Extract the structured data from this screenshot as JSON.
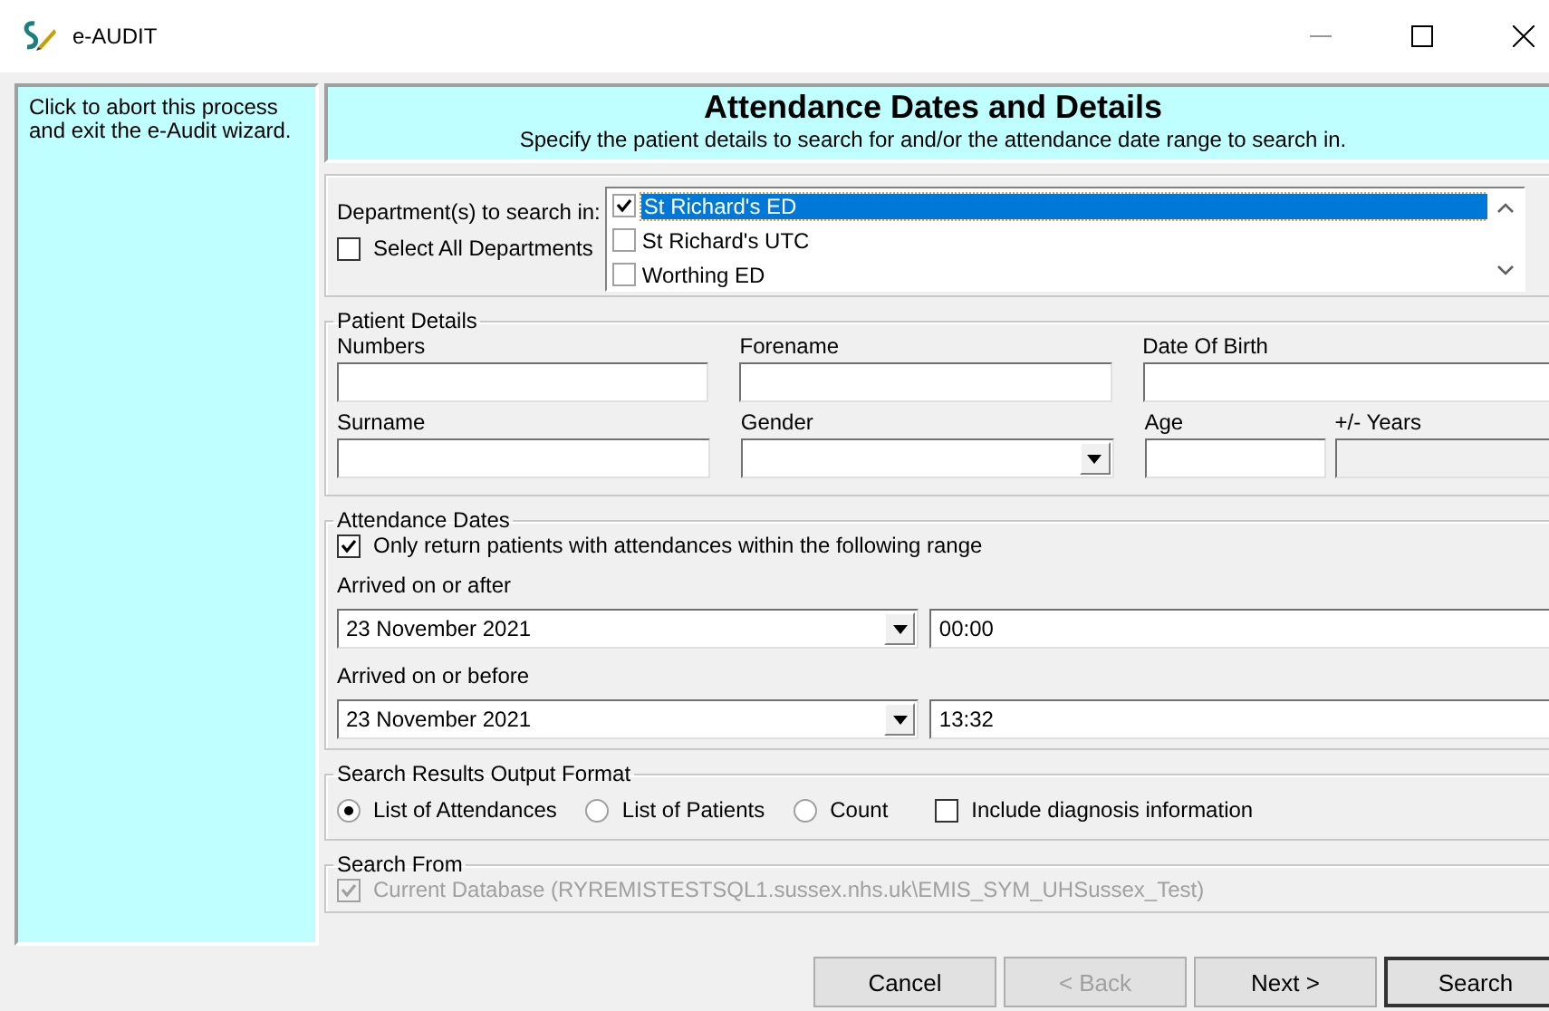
{
  "window": {
    "title": "e-AUDIT"
  },
  "abort_panel": {
    "text": "Click to abort this process and exit the e-Audit wizard."
  },
  "header": {
    "title": "Attendance Dates and Details",
    "subtitle": "Specify the patient details to search for and/or the attendance date range to search in."
  },
  "departments": {
    "label": "Department(s) to search in:",
    "select_all": {
      "label": "Select All Departments",
      "checked": false
    },
    "items": [
      {
        "label": "St Richard's ED",
        "checked": true,
        "selected": true
      },
      {
        "label": "St Richard's UTC",
        "checked": false,
        "selected": false
      },
      {
        "label": "Worthing ED",
        "checked": false,
        "selected": false
      }
    ]
  },
  "patient_details": {
    "legend": "Patient Details",
    "rows": [
      [
        {
          "label": "Numbers",
          "kind": "text"
        },
        {
          "label": "Forename",
          "kind": "text"
        },
        {
          "label": "Date Of Birth",
          "kind": "text"
        }
      ],
      [
        {
          "label": "Surname",
          "kind": "text"
        },
        {
          "label": "Gender",
          "kind": "dropdown"
        },
        {
          "label": "Age",
          "kind": "text"
        },
        {
          "label": "+/- Years",
          "kind": "disabled"
        }
      ]
    ]
  },
  "attendance_dates": {
    "legend": "Attendance Dates",
    "range_only": {
      "label": "Only return patients with attendances within the following range",
      "checked": true
    },
    "ranges": [
      {
        "label": "Arrived on or after",
        "date": "23 November 2021",
        "time": "00:00"
      },
      {
        "label": "Arrived on or before",
        "date": "23 November 2021",
        "time": "13:32"
      }
    ]
  },
  "output_format": {
    "legend": "Search Results Output Format",
    "options": [
      {
        "label": "List of Attendances",
        "selected": true
      },
      {
        "label": "List of Patients",
        "selected": false
      },
      {
        "label": "Count",
        "selected": false
      }
    ],
    "include_diagnosis": {
      "label": "Include diagnosis information",
      "checked": false
    }
  },
  "search_from": {
    "legend": "Search From",
    "database": {
      "label": "Current Database (RYREMISTESTSQL1.sussex.nhs.uk\\EMIS_SYM_UHSussex_Test)",
      "checked": true,
      "disabled": true
    }
  },
  "buttons": [
    {
      "label": "Cancel",
      "disabled": false,
      "default": false
    },
    {
      "label": "< Back",
      "disabled": true,
      "default": false
    },
    {
      "label": "Next >",
      "disabled": false,
      "default": false
    },
    {
      "label": "Search",
      "disabled": false,
      "default": true
    }
  ]
}
